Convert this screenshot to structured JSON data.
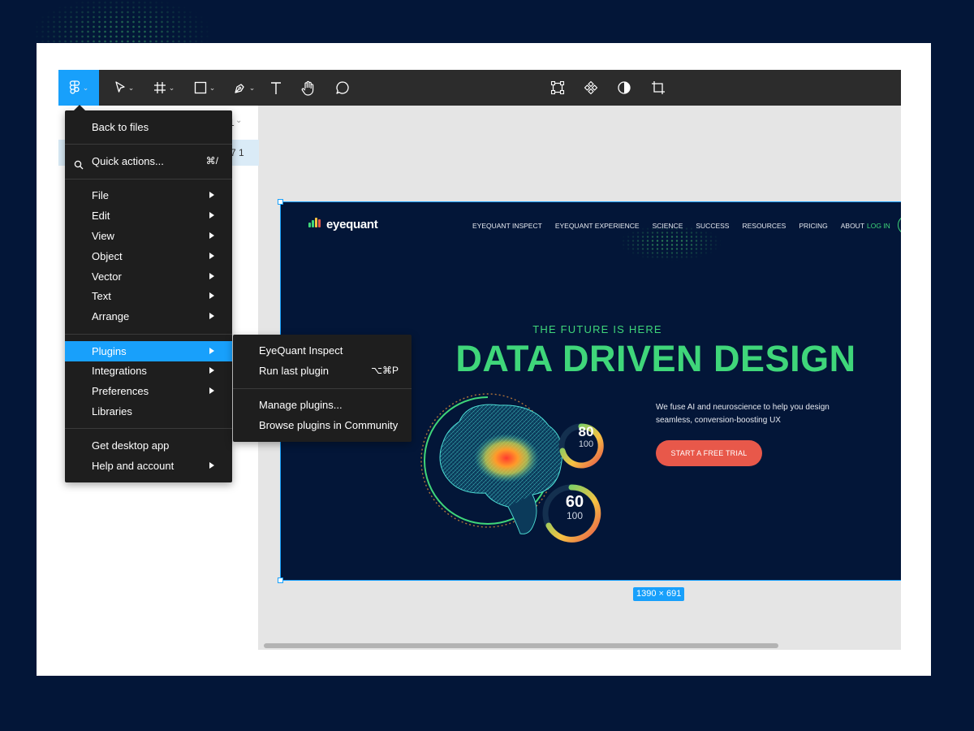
{
  "toolbar": {
    "tools": [
      {
        "name": "figma-menu",
        "icon": "figma-logo-icon"
      },
      {
        "name": "move",
        "icon": "move-arrow-icon"
      },
      {
        "name": "frame",
        "icon": "frame-hash-icon"
      },
      {
        "name": "shape",
        "icon": "rectangle-icon"
      },
      {
        "name": "pen",
        "icon": "pen-icon"
      },
      {
        "name": "text",
        "icon": "text-icon"
      },
      {
        "name": "hand",
        "icon": "hand-icon"
      },
      {
        "name": "comment",
        "icon": "comment-icon"
      }
    ],
    "center_tools": [
      {
        "name": "edit-object",
        "icon": "edit-object-icon"
      },
      {
        "name": "component",
        "icon": "component-icon"
      },
      {
        "name": "mask",
        "icon": "mask-icon"
      },
      {
        "name": "crop",
        "icon": "crop-icon"
      }
    ],
    "accent_color": "#18a0fb"
  },
  "left_panel": {
    "page_fragment": "1",
    "layer_fragment": "7 1"
  },
  "main_menu": {
    "back": "Back to files",
    "quick_actions": "Quick actions...",
    "quick_actions_shortcut": "⌘/",
    "items_group1": [
      "File",
      "Edit",
      "View",
      "Object",
      "Vector",
      "Text",
      "Arrange"
    ],
    "plugins": "Plugins",
    "items_group2": [
      "Integrations",
      "Preferences"
    ],
    "libraries": "Libraries",
    "desktop_app": "Get desktop app",
    "help": "Help and account"
  },
  "plugins_submenu": {
    "eyequant": "EyeQuant Inspect",
    "run_last": "Run last plugin",
    "run_last_shortcut": "⌥⌘P",
    "manage": "Manage plugins...",
    "browse": "Browse plugins in Community"
  },
  "frame": {
    "size_label": "1390 × 691"
  },
  "website": {
    "logo_text": "eyequant",
    "nav": [
      "EYEQUANT INSPECT",
      "EYEQUANT EXPERIENCE",
      "SCIENCE",
      "SUCCESS",
      "RESOURCES",
      "PRICING",
      "ABOUT"
    ],
    "login": "LOG IN",
    "tagline": "THE FUTURE IS HERE",
    "headline": "DATA DRIVEN DESIGN",
    "description": "We fuse AI and neuroscience to help you design seamless, conversion-boosting UX",
    "cta": "START A FREE TRIAL",
    "score1": "80",
    "score1_max": "100",
    "score2": "60",
    "score2_max": "100",
    "colors": {
      "background": "#031638",
      "green": "#3fd67a",
      "cta": "#e8584a"
    }
  }
}
